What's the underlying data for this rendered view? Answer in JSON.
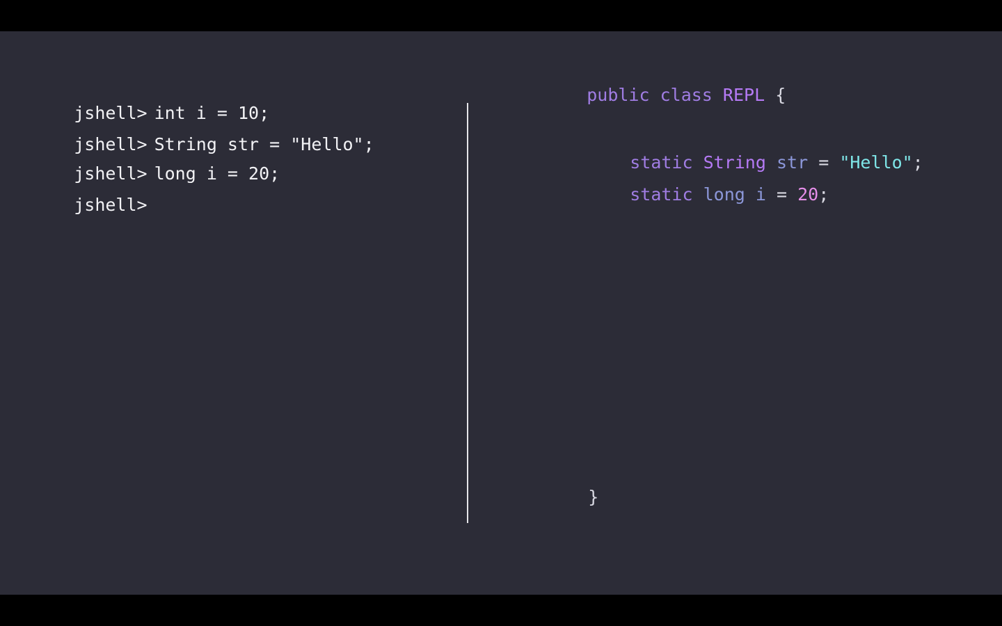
{
  "repl": {
    "prompt": "jshell>",
    "lines": [
      {
        "command": "int i = 10;"
      },
      {
        "command": "String str = \"Hello\";"
      },
      {
        "command": "long i = 20;"
      },
      {
        "command": ""
      }
    ]
  },
  "code": {
    "class_kw1": "public",
    "class_kw2": "class",
    "class_name": "REPL",
    "open_brace": "{",
    "close_brace": "}",
    "field1": {
      "modifier": "static",
      "type": "String",
      "name": "str",
      "op": "=",
      "value": "\"Hello\"",
      "end": ";"
    },
    "field2": {
      "modifier": "static",
      "type": "long",
      "name": "i",
      "op": "=",
      "value": "20",
      "end": ";"
    }
  },
  "colors": {
    "background": "#2c2c37",
    "keyword": "#a07de3",
    "type": "#b57af5",
    "identifier": "#8c97d9",
    "string": "#7fe6e8",
    "number": "#e58ee8"
  }
}
